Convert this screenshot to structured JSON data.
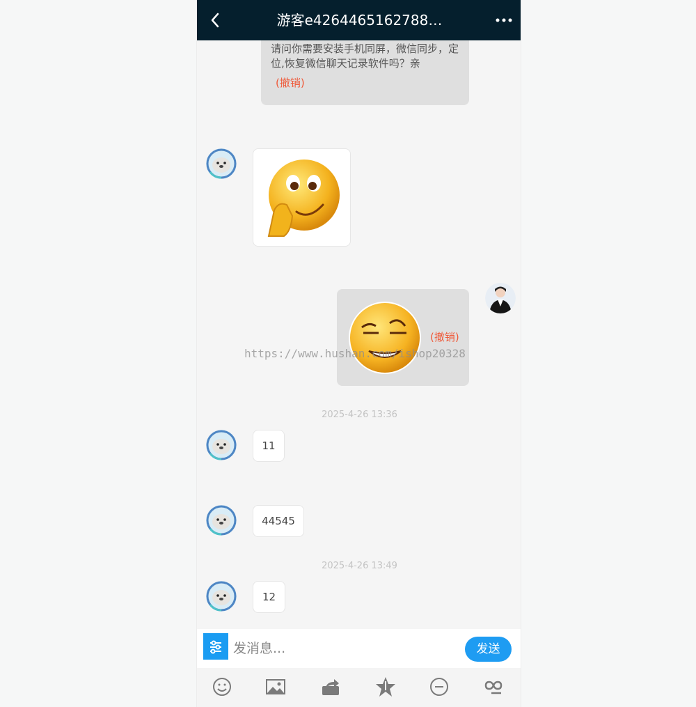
{
  "header": {
    "title": "游客e4264465162788…",
    "back_icon": "chevron-left-icon",
    "more_icon": "more-horizontal-icon"
  },
  "messages": {
    "first_text": "请问你需要安装手机同屏，微信同步，定位,恢复微信聊天记录软件吗？亲",
    "recall_label": "(撤销)",
    "received_sticker": "thinking-face-sticker",
    "sent_sticker": "smirk-face-sticker",
    "watermark": "https://www.hushan.com/ishop20328",
    "timestamp_1": "2025-4-26 13:36",
    "text_11": "11",
    "text_44545": "44545",
    "timestamp_2": "2025-4-26 13:49",
    "text_12": "12"
  },
  "input": {
    "placeholder": "发消息...",
    "send_label": "发送",
    "tools_icon": "sliders-icon"
  },
  "toolbar": {
    "icons": [
      "emoji-icon",
      "image-icon",
      "share-icon",
      "star-icon",
      "block-icon",
      "link-icon"
    ]
  },
  "colors": {
    "header_bg": "#051f2d",
    "accent": "#1e9cf2",
    "recall": "#ef5a3a",
    "bubble_gray": "#dfdfdf"
  }
}
